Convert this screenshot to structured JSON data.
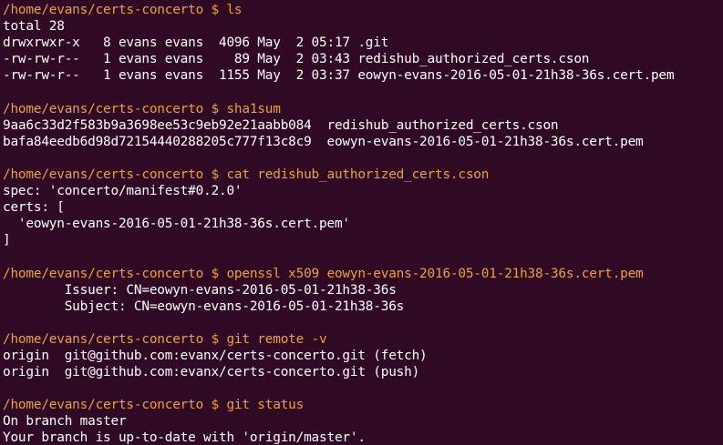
{
  "terminal": {
    "colors": {
      "background": "#300a24",
      "prompt": "#e8a33a",
      "output": "#ffffff"
    },
    "lines": [
      {
        "kind": "prompt",
        "text": "/home/evans/certs-concerto $ ls"
      },
      {
        "kind": "out",
        "text": "total 28"
      },
      {
        "kind": "out",
        "text": "drwxrwxr-x   8 evans evans  4096 May  2 05:17 .git"
      },
      {
        "kind": "out",
        "text": "-rw-rw-r--   1 evans evans    89 May  2 03:43 redishub_authorized_certs.cson"
      },
      {
        "kind": "out",
        "text": "-rw-rw-r--   1 evans evans  1155 May  2 03:37 eowyn-evans-2016-05-01-21h38-36s.cert.pem"
      },
      {
        "kind": "blank",
        "text": ""
      },
      {
        "kind": "prompt",
        "text": "/home/evans/certs-concerto $ sha1sum"
      },
      {
        "kind": "out",
        "text": "9aa6c33d2f583b9a3698ee53c9eb92e21aabb084  redishub_authorized_certs.cson"
      },
      {
        "kind": "out",
        "text": "bafa84eedb6d98d72154440288205c777f13c8c9  eowyn-evans-2016-05-01-21h38-36s.cert.pem"
      },
      {
        "kind": "blank",
        "text": ""
      },
      {
        "kind": "prompt",
        "text": "/home/evans/certs-concerto $ cat redishub_authorized_certs.cson"
      },
      {
        "kind": "out",
        "text": "spec: 'concerto/manifest#0.2.0'"
      },
      {
        "kind": "out",
        "text": "certs: ["
      },
      {
        "kind": "out",
        "text": "  'eowyn-evans-2016-05-01-21h38-36s.cert.pem'"
      },
      {
        "kind": "out",
        "text": "]"
      },
      {
        "kind": "blank",
        "text": ""
      },
      {
        "kind": "prompt",
        "text": "/home/evans/certs-concerto $ openssl x509 eowyn-evans-2016-05-01-21h38-36s.cert.pem"
      },
      {
        "kind": "out",
        "text": "        Issuer: CN=eowyn-evans-2016-05-01-21h38-36s"
      },
      {
        "kind": "out",
        "text": "        Subject: CN=eowyn-evans-2016-05-01-21h38-36s"
      },
      {
        "kind": "blank",
        "text": ""
      },
      {
        "kind": "prompt",
        "text": "/home/evans/certs-concerto $ git remote -v"
      },
      {
        "kind": "out",
        "text": "origin  git@github.com:evanx/certs-concerto.git (fetch)"
      },
      {
        "kind": "out",
        "text": "origin  git@github.com:evanx/certs-concerto.git (push)"
      },
      {
        "kind": "blank",
        "text": ""
      },
      {
        "kind": "prompt",
        "text": "/home/evans/certs-concerto $ git status"
      },
      {
        "kind": "out",
        "text": "On branch master"
      },
      {
        "kind": "out",
        "text": "Your branch is up-to-date with 'origin/master'."
      }
    ]
  }
}
